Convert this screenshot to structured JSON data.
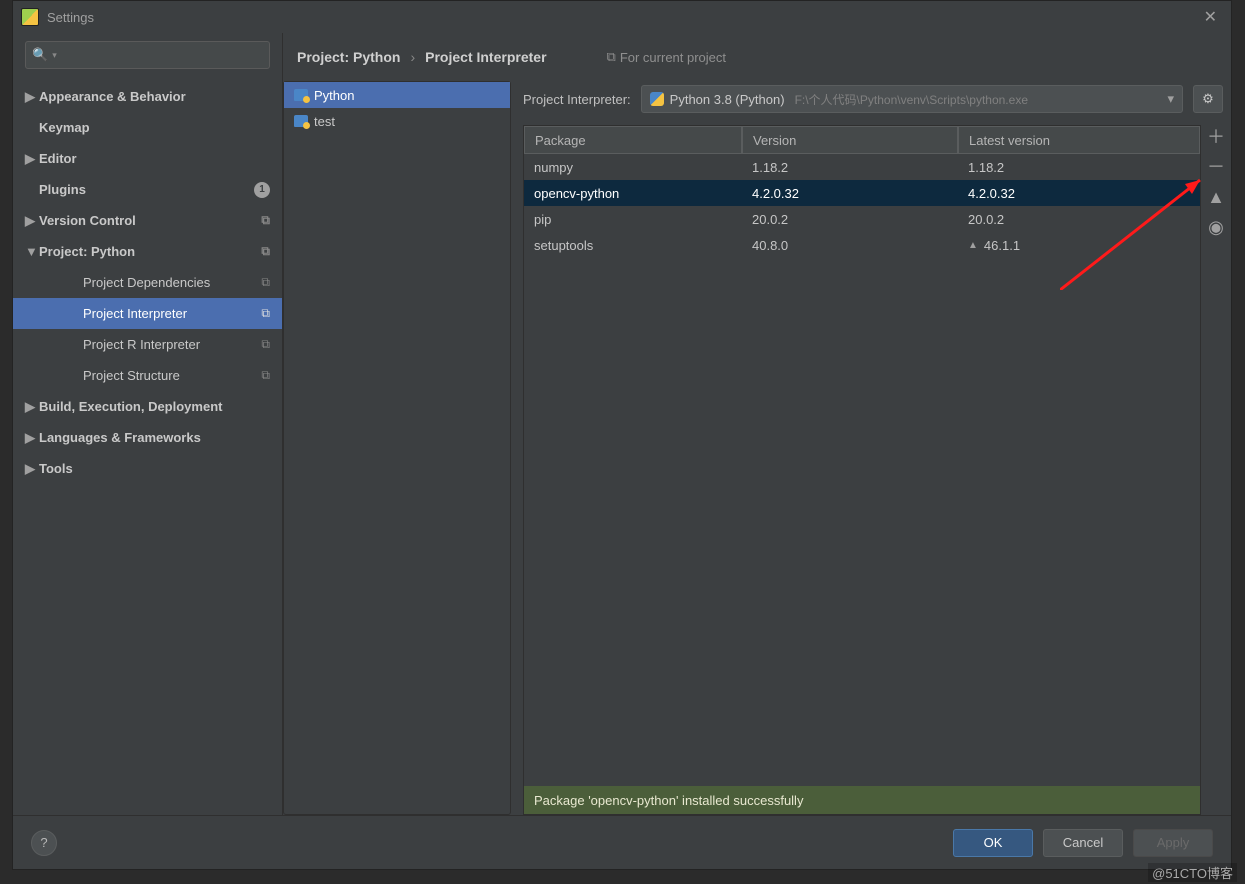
{
  "window": {
    "title": "Settings"
  },
  "sidebar": {
    "search_placeholder": "",
    "items": [
      {
        "label": "Appearance & Behavior",
        "arrow": "▶",
        "bold": true
      },
      {
        "label": "Keymap",
        "arrow": "",
        "bold": true
      },
      {
        "label": "Editor",
        "arrow": "▶",
        "bold": true
      },
      {
        "label": "Plugins",
        "arrow": "",
        "bold": true,
        "badge": "1"
      },
      {
        "label": "Version Control",
        "arrow": "▶",
        "bold": true,
        "copy": true
      },
      {
        "label": "Project: Python",
        "arrow": "▼",
        "bold": true,
        "copy": true
      },
      {
        "label": "Project Dependencies",
        "indent": 2,
        "copy": true
      },
      {
        "label": "Project Interpreter",
        "indent": 2,
        "copy": true,
        "selected": true
      },
      {
        "label": "Project R Interpreter",
        "indent": 2,
        "copy": true
      },
      {
        "label": "Project Structure",
        "indent": 2,
        "copy": true
      },
      {
        "label": "Build, Execution, Deployment",
        "arrow": "▶",
        "bold": true
      },
      {
        "label": "Languages & Frameworks",
        "arrow": "▶",
        "bold": true
      },
      {
        "label": "Tools",
        "arrow": "▶",
        "bold": true
      }
    ]
  },
  "breadcrumb": {
    "c1": "Project: Python",
    "sep": "›",
    "c2": "Project Interpreter",
    "hint": "For current project"
  },
  "project_tree": {
    "items": [
      {
        "label": "Python",
        "selected": true
      },
      {
        "label": "test"
      }
    ]
  },
  "interpreter": {
    "label": "Project Interpreter:",
    "selected": "Python 3.8 (Python)",
    "path": "F:\\个人代码\\Python\\venv\\Scripts\\python.exe"
  },
  "table": {
    "headers": {
      "pkg": "Package",
      "ver": "Version",
      "lat": "Latest version"
    },
    "rows": [
      {
        "pkg": "numpy",
        "ver": "1.18.2",
        "lat": "1.18.2"
      },
      {
        "pkg": "opencv-python",
        "ver": "4.2.0.32",
        "lat": "4.2.0.32",
        "selected": true
      },
      {
        "pkg": "pip",
        "ver": "20.0.2",
        "lat": "20.0.2"
      },
      {
        "pkg": "setuptools",
        "ver": "40.8.0",
        "lat": "46.1.1",
        "upgrade": true
      }
    ]
  },
  "status": "Package 'opencv-python' installed successfully",
  "footer": {
    "ok": "OK",
    "cancel": "Cancel",
    "apply": "Apply",
    "help": "?"
  },
  "watermark": "@51CTO博客"
}
